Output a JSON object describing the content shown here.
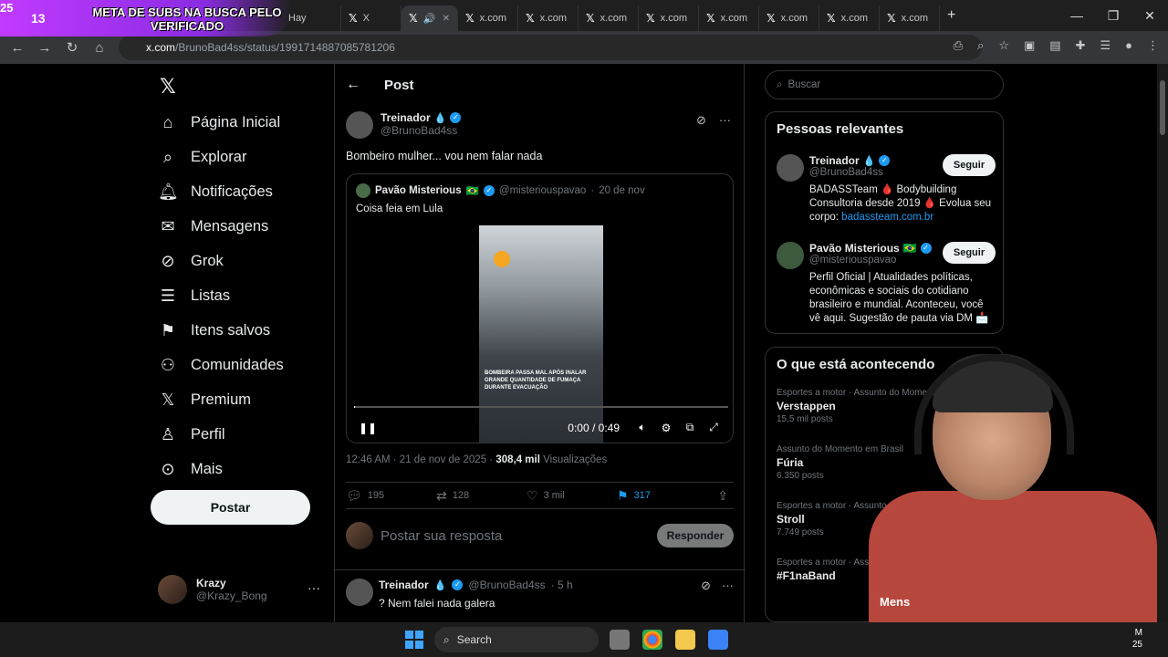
{
  "overlay": {
    "count": "13",
    "text": "META DE SUBS NA BUSCA PELO VERIFICADO",
    "count2": "25"
  },
  "browser": {
    "tabs": [
      {
        "label": "Hay"
      },
      {
        "label": "X"
      },
      {
        "label": ""
      },
      {
        "label": "x.com"
      },
      {
        "label": "x.com"
      },
      {
        "label": "x.com"
      },
      {
        "label": "x.com"
      },
      {
        "label": "x.com"
      },
      {
        "label": "x.com"
      },
      {
        "label": "x.com"
      },
      {
        "label": "x.com"
      }
    ],
    "url_host": "x.com",
    "url_path": "/BrunoBad4ss/status/1991714887085781206"
  },
  "nav": {
    "items": [
      "Página Inicial",
      "Explorar",
      "Notificações",
      "Mensagens",
      "Grok",
      "Listas",
      "Itens salvos",
      "Comunidades",
      "Premium",
      "Perfil",
      "Mais"
    ],
    "post_button": "Postar",
    "account_name": "Krazy",
    "account_handle": "@Krazy_Bong"
  },
  "post": {
    "header": "Post",
    "author_name": "Treinador",
    "author_handle": "@BrunoBad4ss",
    "text": "Bombeiro mulher... vou nem falar nada",
    "quote": {
      "name": "Pavão Misterious",
      "handle": "@misteriouspavao",
      "date": "20 de nov",
      "text": "Coisa feia em Lula",
      "video_caption": "BOMBEIRA PASSA MAL APÓS INALAR GRANDE QUANTIDADE DE FUMAÇA DURANTE EVACUAÇÃO",
      "video_time": "0:00 / 0:49"
    },
    "timestamp": "12:46 AM · 21 de nov de 2025 · ",
    "views": "308,4 mil",
    "views_label": " Visualizações",
    "stats": {
      "replies": "195",
      "reposts": "128",
      "likes": "3 mil",
      "bookmarks": "317"
    },
    "reply_placeholder": "Postar sua resposta",
    "reply_button": "Responder"
  },
  "reply_tweet": {
    "name": "Treinador",
    "handle": "@BrunoBad4ss",
    "time": "· 5 h",
    "text": "? Nem falei nada galera"
  },
  "sidebar": {
    "search_placeholder": "Buscar",
    "relevant_title": "Pessoas relevantes",
    "people": [
      {
        "name": "Treinador",
        "handle": "@BrunoBad4ss",
        "bio": "BADASSTeam 🩸 Bodybuilding Consultoria desde 2019 🩸 Evolua seu corpo: ",
        "link": "badassteam.com.br",
        "button": "Seguir"
      },
      {
        "name": "Pavão Misterious",
        "handle": "@misteriouspavao",
        "bio": "Perfil Oficial | Atualidades políticas, econômicas e sociais do cotidiano brasileiro e mundial. Aconteceu, você vê aqui. Sugestão de pauta via DM 📩",
        "link": "",
        "button": "Seguir"
      }
    ],
    "trends_title": "O que está acontecendo",
    "trends": [
      {
        "context": "Esportes a motor · Assunto do Momento",
        "name": "Verstappen",
        "count": "15,5 mil posts"
      },
      {
        "context": "Assunto do Momento em Brasil",
        "name": "Fúria",
        "count": "6.350 posts"
      },
      {
        "context": "Esportes a motor · Assunto do Momento",
        "name": "Stroll",
        "count": "7.749 posts"
      },
      {
        "context": "Esportes a motor · Assunto do Momento",
        "name": "#F1naBand",
        "count": ""
      }
    ],
    "messages_label": "Mens"
  },
  "taskbar": {
    "search": "Search",
    "clock_line1": "M",
    "clock_line2": "25"
  },
  "colors": {
    "accent": "#1d9bf0",
    "overlay": "#c13bff",
    "background": "#000000"
  }
}
